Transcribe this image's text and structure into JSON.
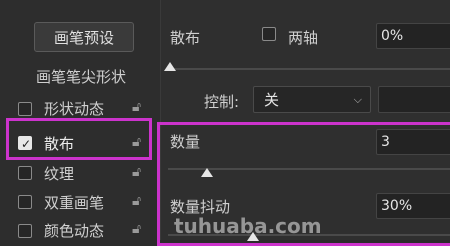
{
  "brush_presets_button": "画笔预设",
  "brush_tip_shape": "画笔笔尖形状",
  "sidebar": {
    "items": [
      {
        "label": "形状动态",
        "checked": false
      },
      {
        "label": "散布",
        "checked": true
      },
      {
        "label": "纹理",
        "checked": false
      },
      {
        "label": "双重画笔",
        "checked": false
      },
      {
        "label": "颜色动态",
        "checked": false
      }
    ]
  },
  "scatter": {
    "label": "散布",
    "both_axes_label": "两轴",
    "value": "0%",
    "control_label": "控制:",
    "control_value": "关"
  },
  "count": {
    "label": "数量",
    "value": "3"
  },
  "count_jitter": {
    "label": "数量抖动",
    "value": "30%"
  },
  "watermark": "tuhuaba.com",
  "colors": {
    "highlight": "#cc33cc",
    "background": "#2b2b2b"
  }
}
